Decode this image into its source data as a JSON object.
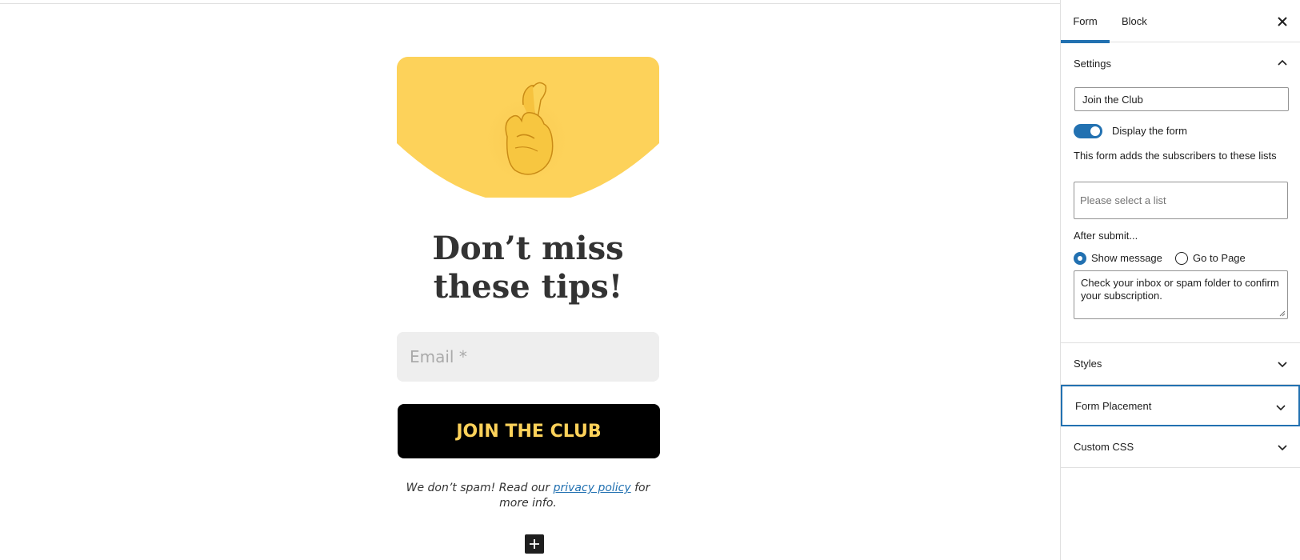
{
  "canvas": {
    "hero_icon": "crossed-fingers-emoji",
    "heading": "Don’t miss these tips!",
    "email_placeholder": "Email *",
    "join_button": "JOIN THE CLUB",
    "fine_print_before": "We don’t spam! Read our ",
    "fine_print_link": "privacy policy",
    "fine_print_after": " for more info.",
    "colors": {
      "hero_bg": "#fdd25a",
      "button_bg": "#000000",
      "button_text": "#fdd25a",
      "link": "#2271b1"
    }
  },
  "sidebar": {
    "tabs": [
      {
        "label": "Form",
        "active": true
      },
      {
        "label": "Block",
        "active": false
      }
    ],
    "close_icon": "close-icon",
    "settings": {
      "title": "Settings",
      "form_name": "Join the Club",
      "display_label": "Display the form",
      "display_on": true,
      "lists_label": "This form adds the subscribers to these lists",
      "list_placeholder": "Please select a list",
      "after_submit_label": "After submit...",
      "radio_show": "Show message",
      "radio_page": "Go to Page",
      "selected": "Show message",
      "message": "Check your inbox or spam folder to confirm your subscription."
    },
    "panels": [
      {
        "label": "Styles"
      },
      {
        "label": "Form Placement"
      },
      {
        "label": "Custom CSS"
      }
    ],
    "accent_color": "#2271b1"
  }
}
